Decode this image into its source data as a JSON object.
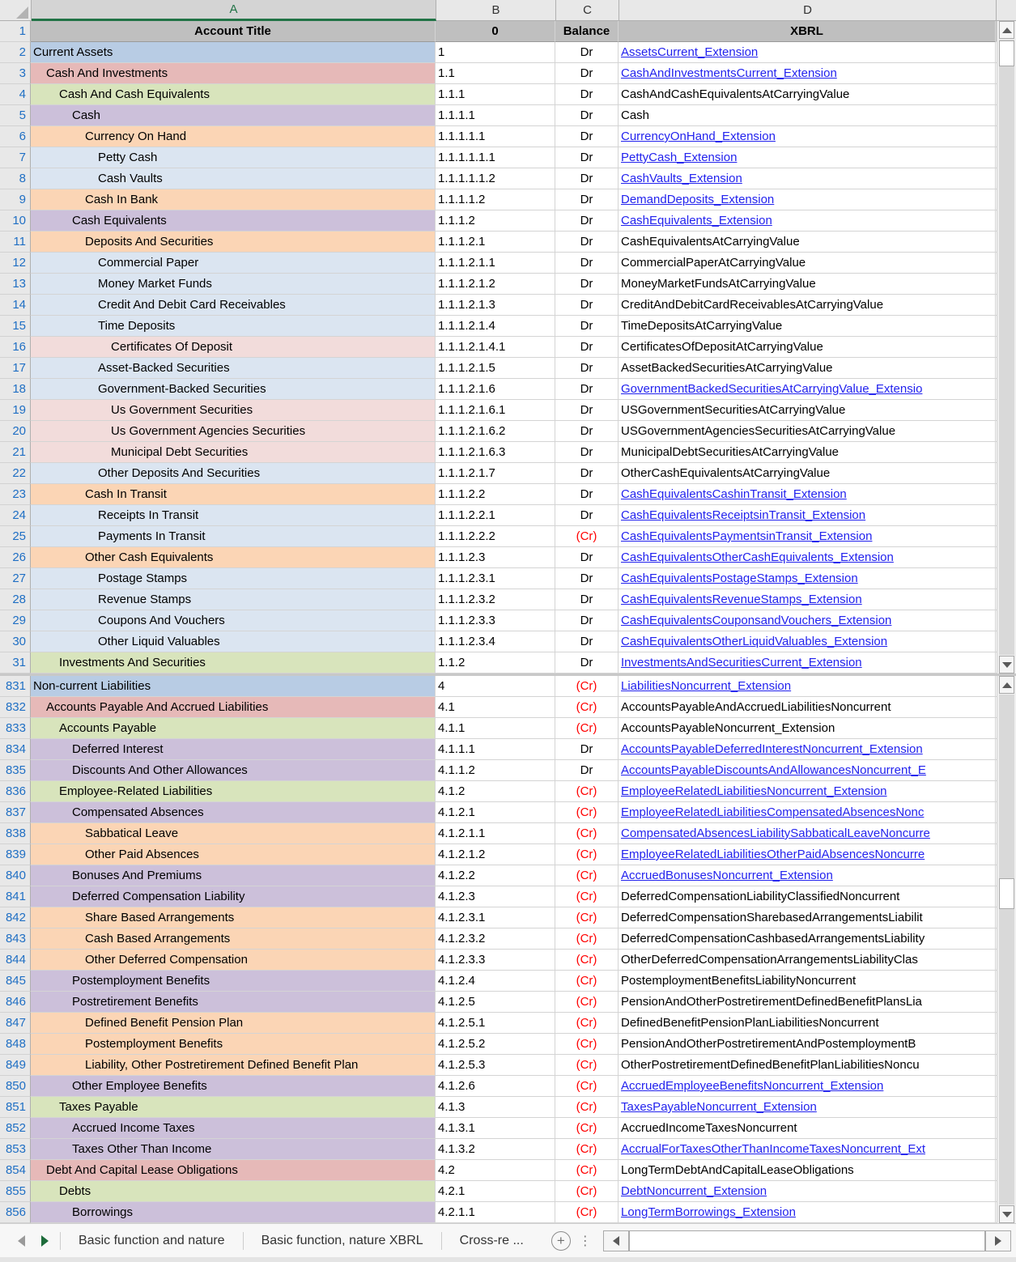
{
  "columns": {
    "headers": [
      {
        "letter": "A",
        "selected": true
      },
      {
        "letter": "B",
        "selected": false
      },
      {
        "letter": "C",
        "selected": false
      },
      {
        "letter": "D",
        "selected": false
      }
    ]
  },
  "header_row": {
    "number": "1",
    "a": "Account Title",
    "b": "0",
    "c": "Balance",
    "d": "XBRL"
  },
  "top_pane": {
    "rows": [
      {
        "n": "2",
        "title": "Current Assets",
        "code": "1",
        "bal": "Dr",
        "xbrl": "AssetsCurrent_Extension",
        "link": true,
        "tint": "t-blue",
        "ind": 0
      },
      {
        "n": "3",
        "title": "Cash And Investments",
        "code": "1.1",
        "bal": "Dr",
        "xbrl": "CashAndInvestmentsCurrent_Extension",
        "link": true,
        "tint": "t-red",
        "ind": 1
      },
      {
        "n": "4",
        "title": "Cash And Cash Equivalents",
        "code": "1.1.1",
        "bal": "Dr",
        "xbrl": "CashAndCashEquivalentsAtCarryingValue",
        "link": false,
        "tint": "t-green",
        "ind": 2
      },
      {
        "n": "5",
        "title": "Cash",
        "code": "1.1.1.1",
        "bal": "Dr",
        "xbrl": "Cash",
        "link": false,
        "tint": "t-purple",
        "ind": 3
      },
      {
        "n": "6",
        "title": "Currency On Hand",
        "code": "1.1.1.1.1",
        "bal": "Dr",
        "xbrl": "CurrencyOnHand_Extension",
        "link": true,
        "tint": "t-orange",
        "ind": 4
      },
      {
        "n": "7",
        "title": "Petty Cash",
        "code": "1.1.1.1.1.1",
        "bal": "Dr",
        "xbrl": "PettyCash_Extension",
        "link": true,
        "tint": "t-lblue",
        "ind": 5
      },
      {
        "n": "8",
        "title": "Cash Vaults",
        "code": "1.1.1.1.1.2",
        "bal": "Dr",
        "xbrl": "CashVaults_Extension",
        "link": true,
        "tint": "t-lblue",
        "ind": 5
      },
      {
        "n": "9",
        "title": "Cash In Bank",
        "code": "1.1.1.1.2",
        "bal": "Dr",
        "xbrl": "DemandDeposits_Extension",
        "link": true,
        "tint": "t-orange",
        "ind": 4
      },
      {
        "n": "10",
        "title": "Cash Equivalents",
        "code": "1.1.1.2",
        "bal": "Dr",
        "xbrl": "CashEquivalents_Extension",
        "link": true,
        "tint": "t-purple",
        "ind": 3
      },
      {
        "n": "11",
        "title": "Deposits And Securities",
        "code": "1.1.1.2.1",
        "bal": "Dr",
        "xbrl": "CashEquivalentsAtCarryingValue",
        "link": false,
        "tint": "t-orange",
        "ind": 4
      },
      {
        "n": "12",
        "title": "Commercial Paper",
        "code": "1.1.1.2.1.1",
        "bal": "Dr",
        "xbrl": "CommercialPaperAtCarryingValue",
        "link": false,
        "tint": "t-lblue",
        "ind": 5
      },
      {
        "n": "13",
        "title": "Money Market Funds",
        "code": "1.1.1.2.1.2",
        "bal": "Dr",
        "xbrl": "MoneyMarketFundsAtCarryingValue",
        "link": false,
        "tint": "t-lblue",
        "ind": 5
      },
      {
        "n": "14",
        "title": "Credit And Debit Card Receivables",
        "code": "1.1.1.2.1.3",
        "bal": "Dr",
        "xbrl": "CreditAndDebitCardReceivablesAtCarryingValue",
        "link": false,
        "tint": "t-lblue",
        "ind": 5
      },
      {
        "n": "15",
        "title": "Time Deposits",
        "code": "1.1.1.2.1.4",
        "bal": "Dr",
        "xbrl": "TimeDepositsAtCarryingValue",
        "link": false,
        "tint": "t-lblue",
        "ind": 5
      },
      {
        "n": "16",
        "title": "Certificates Of Deposit",
        "code": "1.1.1.2.1.4.1",
        "bal": "Dr",
        "xbrl": "CertificatesOfDepositAtCarryingValue",
        "link": false,
        "tint": "t-lred",
        "ind": 6
      },
      {
        "n": "17",
        "title": "Asset-Backed Securities",
        "code": "1.1.1.2.1.5",
        "bal": "Dr",
        "xbrl": "AssetBackedSecuritiesAtCarryingValue",
        "link": false,
        "tint": "t-lblue",
        "ind": 5
      },
      {
        "n": "18",
        "title": "Government-Backed Securities",
        "code": "1.1.1.2.1.6",
        "bal": "Dr",
        "xbrl": "GovernmentBackedSecuritiesAtCarryingValue_Extensio",
        "link": true,
        "tint": "t-lblue",
        "ind": 5
      },
      {
        "n": "19",
        "title": "Us Government Securities",
        "code": "1.1.1.2.1.6.1",
        "bal": "Dr",
        "xbrl": "USGovernmentSecuritiesAtCarryingValue",
        "link": false,
        "tint": "t-lred",
        "ind": 6
      },
      {
        "n": "20",
        "title": "Us Government Agencies Securities",
        "code": "1.1.1.2.1.6.2",
        "bal": "Dr",
        "xbrl": "USGovernmentAgenciesSecuritiesAtCarryingValue",
        "link": false,
        "tint": "t-lred",
        "ind": 6
      },
      {
        "n": "21",
        "title": "Municipal Debt Securities",
        "code": "1.1.1.2.1.6.3",
        "bal": "Dr",
        "xbrl": "MunicipalDebtSecuritiesAtCarryingValue",
        "link": false,
        "tint": "t-lred",
        "ind": 6
      },
      {
        "n": "22",
        "title": "Other Deposits And Securities",
        "code": "1.1.1.2.1.7",
        "bal": "Dr",
        "xbrl": "OtherCashEquivalentsAtCarryingValue",
        "link": false,
        "tint": "t-lblue",
        "ind": 5
      },
      {
        "n": "23",
        "title": "Cash In Transit",
        "code": "1.1.1.2.2",
        "bal": "Dr",
        "xbrl": "CashEquivalentsCashinTransit_Extension",
        "link": true,
        "tint": "t-orange",
        "ind": 4
      },
      {
        "n": "24",
        "title": "Receipts In Transit",
        "code": "1.1.1.2.2.1",
        "bal": "Dr",
        "xbrl": "CashEquivalentsReceiptsinTransit_Extension",
        "link": true,
        "tint": "t-lblue",
        "ind": 5
      },
      {
        "n": "25",
        "title": "Payments In Transit",
        "code": "1.1.1.2.2.2",
        "bal": "(Cr)",
        "xbrl": "CashEquivalentsPaymentsinTransit_Extension",
        "link": true,
        "tint": "t-lblue",
        "ind": 5
      },
      {
        "n": "26",
        "title": "Other Cash Equivalents",
        "code": "1.1.1.2.3",
        "bal": "Dr",
        "xbrl": "CashEquivalentsOtherCashEquivalents_Extension",
        "link": true,
        "tint": "t-orange",
        "ind": 4
      },
      {
        "n": "27",
        "title": "Postage Stamps",
        "code": "1.1.1.2.3.1",
        "bal": "Dr",
        "xbrl": "CashEquivalentsPostageStamps_Extension",
        "link": true,
        "tint": "t-lblue",
        "ind": 5
      },
      {
        "n": "28",
        "title": "Revenue Stamps",
        "code": "1.1.1.2.3.2",
        "bal": "Dr",
        "xbrl": "CashEquivalentsRevenueStamps_Extension",
        "link": true,
        "tint": "t-lblue",
        "ind": 5
      },
      {
        "n": "29",
        "title": "Coupons And Vouchers",
        "code": "1.1.1.2.3.3",
        "bal": "Dr",
        "xbrl": "CashEquivalentsCouponsandVouchers_Extension",
        "link": true,
        "tint": "t-lblue",
        "ind": 5
      },
      {
        "n": "30",
        "title": "Other Liquid Valuables",
        "code": "1.1.1.2.3.4",
        "bal": "Dr",
        "xbrl": "CashEquivalentsOtherLiquidValuables_Extension",
        "link": true,
        "tint": "t-lblue",
        "ind": 5
      },
      {
        "n": "31",
        "title": "Investments And Securities",
        "code": "1.1.2",
        "bal": "Dr",
        "xbrl": "InvestmentsAndSecuritiesCurrent_Extension",
        "link": true,
        "tint": "t-green",
        "ind": 2
      }
    ]
  },
  "bottom_pane": {
    "rows": [
      {
        "n": "831",
        "title": "Non-current Liabilities",
        "code": "4",
        "bal": "(Cr)",
        "xbrl": "LiabilitiesNoncurrent_Extension",
        "link": true,
        "tint": "t-blue",
        "ind": 0
      },
      {
        "n": "832",
        "title": "Accounts Payable And Accrued Liabilities",
        "code": "4.1",
        "bal": "(Cr)",
        "xbrl": "AccountsPayableAndAccruedLiabilitiesNoncurrent",
        "link": false,
        "tint": "t-red",
        "ind": 1
      },
      {
        "n": "833",
        "title": "Accounts Payable",
        "code": "4.1.1",
        "bal": "(Cr)",
        "xbrl": "AccountsPayableNoncurrent_Extension",
        "link": false,
        "tint": "t-green",
        "ind": 2
      },
      {
        "n": "834",
        "title": "Deferred Interest",
        "code": "4.1.1.1",
        "bal": "Dr",
        "xbrl": "AccountsPayableDeferredInterestNoncurrent_Extension",
        "link": true,
        "tint": "t-purple",
        "ind": 3
      },
      {
        "n": "835",
        "title": "Discounts And Other Allowances",
        "code": "4.1.1.2",
        "bal": "Dr",
        "xbrl": "AccountsPayableDiscountsAndAllowancesNoncurrent_E",
        "link": true,
        "tint": "t-purple",
        "ind": 3
      },
      {
        "n": "836",
        "title": "Employee-Related Liabilities",
        "code": "4.1.2",
        "bal": "(Cr)",
        "xbrl": "EmployeeRelatedLiabilitiesNoncurrent_Extension",
        "link": true,
        "tint": "t-green",
        "ind": 2
      },
      {
        "n": "837",
        "title": "Compensated Absences",
        "code": "4.1.2.1",
        "bal": "(Cr)",
        "xbrl": "EmployeeRelatedLiabilitiesCompensatedAbsencesNonc",
        "link": true,
        "tint": "t-purple",
        "ind": 3
      },
      {
        "n": "838",
        "title": "Sabbatical Leave",
        "code": "4.1.2.1.1",
        "bal": "(Cr)",
        "xbrl": "CompensatedAbsencesLiabilitySabbaticalLeaveNoncurre",
        "link": true,
        "tint": "t-orange",
        "ind": 4
      },
      {
        "n": "839",
        "title": "Other Paid Absences",
        "code": "4.1.2.1.2",
        "bal": "(Cr)",
        "xbrl": "EmployeeRelatedLiabilitiesOtherPaidAbsencesNoncurre",
        "link": true,
        "tint": "t-orange",
        "ind": 4
      },
      {
        "n": "840",
        "title": "Bonuses And Premiums",
        "code": "4.1.2.2",
        "bal": "(Cr)",
        "xbrl": "AccruedBonusesNoncurrent_Extension",
        "link": true,
        "tint": "t-purple",
        "ind": 3
      },
      {
        "n": "841",
        "title": "Deferred Compensation Liability",
        "code": "4.1.2.3",
        "bal": "(Cr)",
        "xbrl": "DeferredCompensationLiabilityClassifiedNoncurrent",
        "link": false,
        "tint": "t-purple",
        "ind": 3
      },
      {
        "n": "842",
        "title": "Share Based Arrangements",
        "code": "4.1.2.3.1",
        "bal": "(Cr)",
        "xbrl": "DeferredCompensationSharebasedArrangementsLiabilit",
        "link": false,
        "tint": "t-orange",
        "ind": 4
      },
      {
        "n": "843",
        "title": "Cash Based Arrangements",
        "code": "4.1.2.3.2",
        "bal": "(Cr)",
        "xbrl": "DeferredCompensationCashbasedArrangementsLiability",
        "link": false,
        "tint": "t-orange",
        "ind": 4
      },
      {
        "n": "844",
        "title": "Other Deferred Compensation",
        "code": "4.1.2.3.3",
        "bal": "(Cr)",
        "xbrl": "OtherDeferredCompensationArrangementsLiabilityClas",
        "link": false,
        "tint": "t-orange",
        "ind": 4
      },
      {
        "n": "845",
        "title": "Postemployment Benefits",
        "code": "4.1.2.4",
        "bal": "(Cr)",
        "xbrl": "PostemploymentBenefitsLiabilityNoncurrent",
        "link": false,
        "tint": "t-purple",
        "ind": 3
      },
      {
        "n": "846",
        "title": "Postretirement Benefits",
        "code": "4.1.2.5",
        "bal": "(Cr)",
        "xbrl": "PensionAndOtherPostretirementDefinedBenefitPlansLia",
        "link": false,
        "tint": "t-purple",
        "ind": 3
      },
      {
        "n": "847",
        "title": "Defined Benefit Pension Plan",
        "code": "4.1.2.5.1",
        "bal": "(Cr)",
        "xbrl": "DefinedBenefitPensionPlanLiabilitiesNoncurrent",
        "link": false,
        "tint": "t-orange",
        "ind": 4
      },
      {
        "n": "848",
        "title": "Postemployment Benefits",
        "code": "4.1.2.5.2",
        "bal": "(Cr)",
        "xbrl": "PensionAndOtherPostretirementAndPostemploymentB",
        "link": false,
        "tint": "t-orange",
        "ind": 4
      },
      {
        "n": "849",
        "title": "Liability, Other Postretirement Defined Benefit Plan",
        "code": "4.1.2.5.3",
        "bal": "(Cr)",
        "xbrl": "OtherPostretirementDefinedBenefitPlanLiabilitiesNoncu",
        "link": false,
        "tint": "t-orange",
        "ind": 4
      },
      {
        "n": "850",
        "title": "Other Employee Benefits",
        "code": "4.1.2.6",
        "bal": "(Cr)",
        "xbrl": "AccruedEmployeeBenefitsNoncurrent_Extension",
        "link": true,
        "tint": "t-purple",
        "ind": 3
      },
      {
        "n": "851",
        "title": "Taxes Payable",
        "code": "4.1.3",
        "bal": "(Cr)",
        "xbrl": "TaxesPayableNoncurrent_Extension",
        "link": true,
        "tint": "t-green",
        "ind": 2
      },
      {
        "n": "852",
        "title": "Accrued Income Taxes",
        "code": "4.1.3.1",
        "bal": "(Cr)",
        "xbrl": "AccruedIncomeTaxesNoncurrent",
        "link": false,
        "tint": "t-purple",
        "ind": 3
      },
      {
        "n": "853",
        "title": "Taxes Other Than Income",
        "code": "4.1.3.2",
        "bal": "(Cr)",
        "xbrl": "AccrualForTaxesOtherThanIncomeTaxesNoncurrent_Ext",
        "link": true,
        "tint": "t-purple",
        "ind": 3
      },
      {
        "n": "854",
        "title": "Debt And Capital Lease Obligations",
        "code": "4.2",
        "bal": "(Cr)",
        "xbrl": "LongTermDebtAndCapitalLeaseObligations",
        "link": false,
        "tint": "t-red",
        "ind": 1
      },
      {
        "n": "855",
        "title": "Debts",
        "code": "4.2.1",
        "bal": "(Cr)",
        "xbrl": "DebtNoncurrent_Extension",
        "link": true,
        "tint": "t-green",
        "ind": 2
      },
      {
        "n": "856",
        "title": "Borrowings",
        "code": "4.2.1.1",
        "bal": "(Cr)",
        "xbrl": "LongTermBorrowings_Extension",
        "link": true,
        "tint": "t-purple",
        "ind": 3
      }
    ]
  },
  "sheet_tabs": {
    "prev_label": "◀",
    "next_label": "▶",
    "tabs": [
      {
        "label": "Basic function and nature",
        "active": false
      },
      {
        "label": "Basic function, nature XBRL",
        "active": false
      },
      {
        "label": "Cross-re ...",
        "active": false
      }
    ],
    "add_label": "+",
    "menu_label": "⋮"
  }
}
